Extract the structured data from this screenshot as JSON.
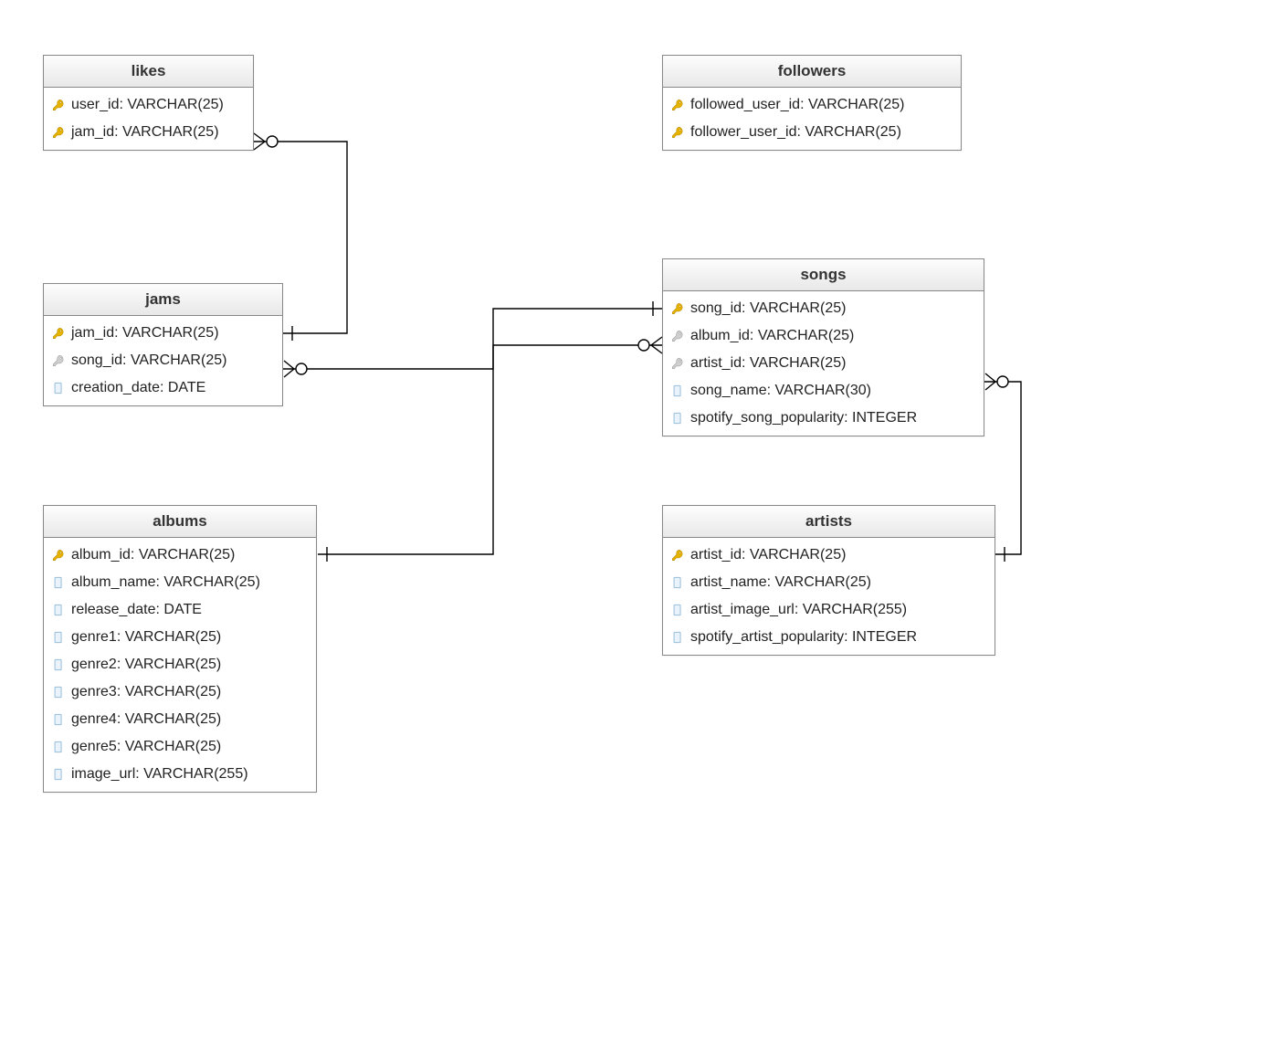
{
  "entities": {
    "likes": {
      "title": "likes",
      "columns": [
        {
          "icon": "pk",
          "text": "user_id: VARCHAR(25)"
        },
        {
          "icon": "pk",
          "text": "jam_id: VARCHAR(25)"
        }
      ]
    },
    "jams": {
      "title": "jams",
      "columns": [
        {
          "icon": "pk",
          "text": "jam_id: VARCHAR(25)"
        },
        {
          "icon": "fk",
          "text": "song_id: VARCHAR(25)"
        },
        {
          "icon": "col",
          "text": "creation_date: DATE"
        }
      ]
    },
    "albums": {
      "title": "albums",
      "columns": [
        {
          "icon": "pk",
          "text": "album_id: VARCHAR(25)"
        },
        {
          "icon": "col",
          "text": "album_name: VARCHAR(25)"
        },
        {
          "icon": "col",
          "text": "release_date: DATE"
        },
        {
          "icon": "col",
          "text": "genre1: VARCHAR(25)"
        },
        {
          "icon": "col",
          "text": "genre2: VARCHAR(25)"
        },
        {
          "icon": "col",
          "text": "genre3: VARCHAR(25)"
        },
        {
          "icon": "col",
          "text": "genre4: VARCHAR(25)"
        },
        {
          "icon": "col",
          "text": "genre5: VARCHAR(25)"
        },
        {
          "icon": "col",
          "text": "image_url: VARCHAR(255)"
        }
      ]
    },
    "followers": {
      "title": "followers",
      "columns": [
        {
          "icon": "pk",
          "text": "followed_user_id: VARCHAR(25)"
        },
        {
          "icon": "pk",
          "text": "follower_user_id: VARCHAR(25)"
        }
      ]
    },
    "songs": {
      "title": "songs",
      "columns": [
        {
          "icon": "pk",
          "text": "song_id: VARCHAR(25)"
        },
        {
          "icon": "fk",
          "text": "album_id: VARCHAR(25)"
        },
        {
          "icon": "fk",
          "text": "artist_id: VARCHAR(25)"
        },
        {
          "icon": "col",
          "text": "song_name: VARCHAR(30)"
        },
        {
          "icon": "col",
          "text": "spotify_song_popularity: INTEGER"
        }
      ]
    },
    "artists": {
      "title": "artists",
      "columns": [
        {
          "icon": "pk",
          "text": "artist_id: VARCHAR(25)"
        },
        {
          "icon": "col",
          "text": "artist_name: VARCHAR(25)"
        },
        {
          "icon": "col",
          "text": "artist_image_url: VARCHAR(255)"
        },
        {
          "icon": "col",
          "text": "spotify_artist_popularity: INTEGER"
        }
      ]
    }
  },
  "relationships": [
    {
      "from": "likes.jam_id",
      "to": "jams.jam_id",
      "type": "many-to-one"
    },
    {
      "from": "jams.song_id",
      "to": "songs.song_id",
      "type": "many-to-one"
    },
    {
      "from": "albums.album_id",
      "to": "songs.album_id",
      "type": "one-to-many"
    },
    {
      "from": "songs.artist_id",
      "to": "artists.artist_id",
      "type": "many-to-one"
    }
  ]
}
